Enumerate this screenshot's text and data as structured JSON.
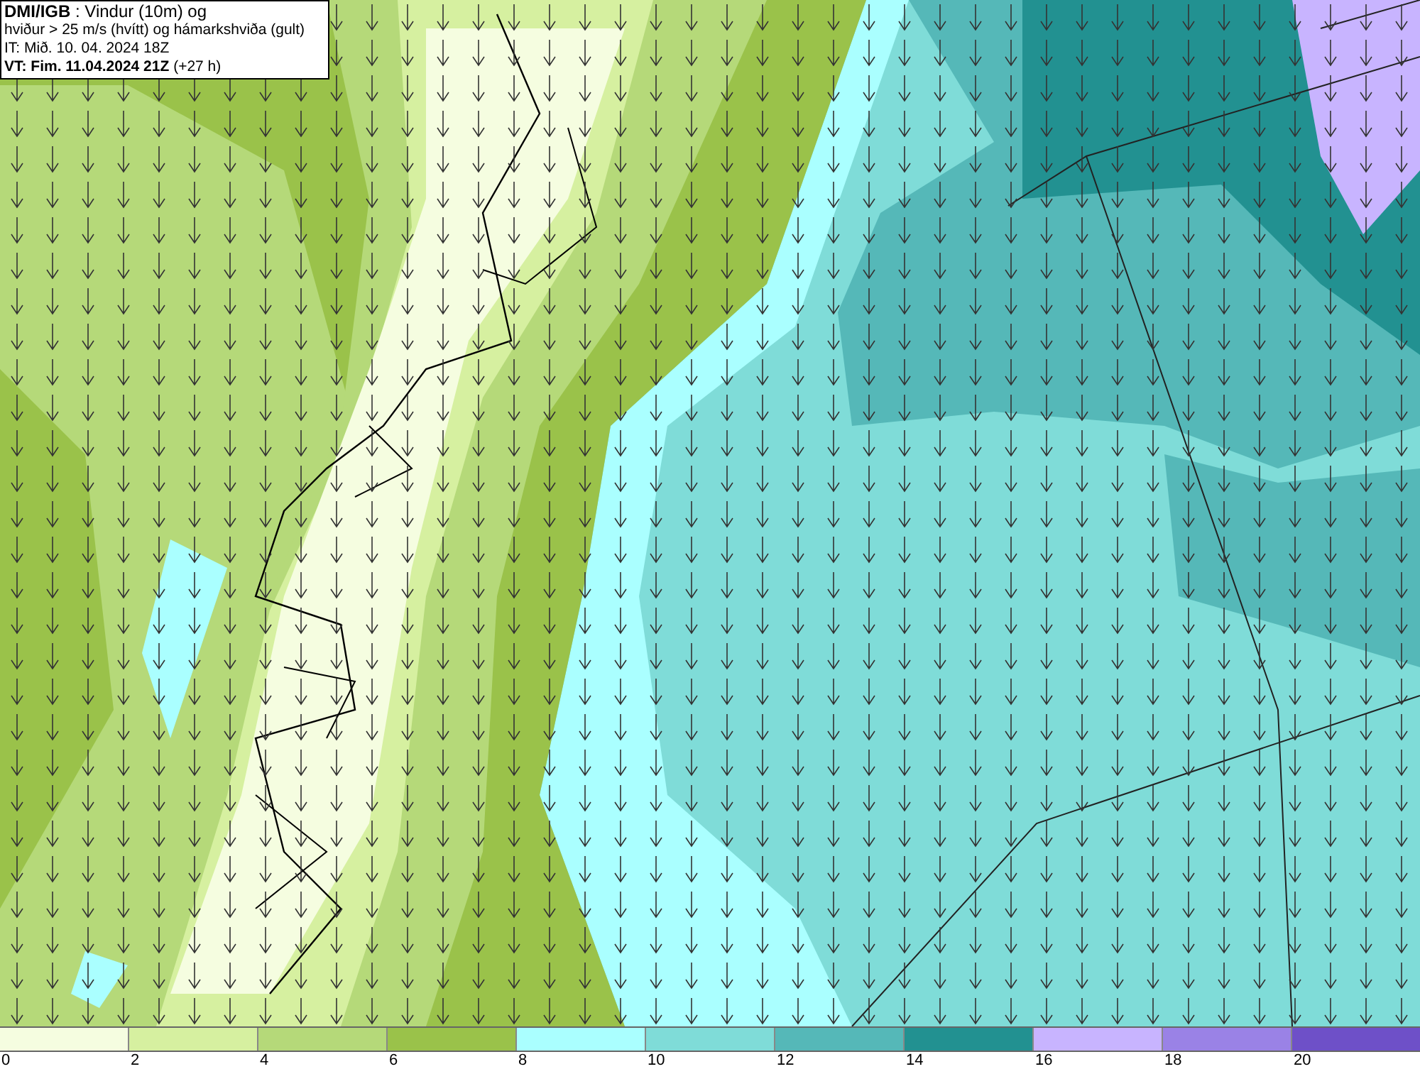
{
  "header": {
    "lines": [
      "**DMI/IGB** : Vindur (10m) og",
      "hviður > 25 m/s (hvítt) og hámarkshviða (gult)",
      "IT: Mið. 10. 04. 2024 18Z",
      "**VT: Fim. 11.04.2024 21Z** (+27 h)"
    ]
  },
  "legend": {
    "swatches": [
      {
        "color": "#f5fde0"
      },
      {
        "color": "#d6f0a0"
      },
      {
        "color": "#b5d979"
      },
      {
        "color": "#9ac24a"
      },
      {
        "color": "#aaffff"
      },
      {
        "color": "#7fdcd8"
      },
      {
        "color": "#55b8b8"
      },
      {
        "color": "#229191"
      },
      {
        "color": "#c8b4ff"
      },
      {
        "color": "#9a82e6"
      },
      {
        "color": "#6e50c8"
      }
    ],
    "ticks": [
      "0",
      "2",
      "4",
      "6",
      "8",
      "10",
      "12",
      "14",
      "16",
      "18",
      "20"
    ]
  }
}
